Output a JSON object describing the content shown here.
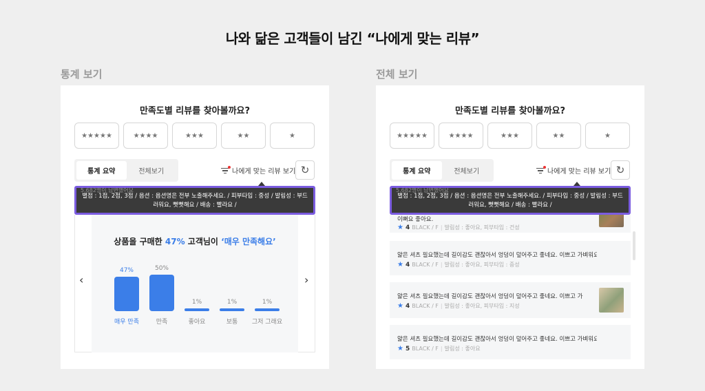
{
  "headline": "나와 닮은 고객들이 남긴 “나에게 맞는 리뷰”",
  "left_panel": {
    "section_label": "통계 보기",
    "title": "만족도별 리뷰를 찾아볼까요?",
    "star_filters": [
      "★★★★★",
      "★★★★",
      "★★★",
      "★★",
      "★"
    ],
    "tabs": [
      "통계 요약",
      "전체보기"
    ],
    "active_tab": "통계 요약",
    "match_link": "나에게 맞는 리뷰 보기",
    "tooltip_behind": "5,682명이 답변했어요",
    "tooltip": "별점 : 1점, 2점, 3점 / 옵션 : 옵션명은 전부 노출해주세요. / 피부타입 : 중성 / 발림성 : 부드러워요, 뻣뻣해요 / 배송 : 빨라요 /",
    "stats_sentence": {
      "prefix": "상품을 구매한 ",
      "percent": "47%",
      "middle": " 고객님이 ",
      "quote": "‘매우 만족해요’"
    },
    "nav_prev": "‹",
    "nav_next": "›"
  },
  "chart_data": {
    "type": "bar",
    "categories": [
      "매우 만족",
      "만족",
      "좋아요",
      "보통",
      "그저 그래요"
    ],
    "values": [
      47,
      50,
      1,
      1,
      1
    ],
    "value_labels": [
      "47%",
      "50%",
      "1%",
      "1%",
      "1%"
    ],
    "highlight_index": 0,
    "title": "",
    "xlabel": "",
    "ylabel": "",
    "ylim": [
      0,
      100
    ],
    "grid": false,
    "colors": {
      "bar": "#3b7ee8",
      "highlight_text": "#3b7ee8",
      "text": "#888888"
    }
  },
  "right_panel": {
    "section_label": "전체 보기",
    "title": "만족도별 리뷰를 찾아볼까요?",
    "star_filters": [
      "★★★★★",
      "★★★★",
      "★★★",
      "★★",
      "★"
    ],
    "tabs": [
      "통계 요약",
      "전체보기"
    ],
    "active_tab": "통계 요약",
    "match_link": "나에게 맞는 리뷰 보기",
    "tooltip_behind": "5,682명이 답변했어요",
    "tooltip": "별점 : 1점, 2점, 3점 / 옵션 : 옵션명은 전부 노출해주세요. / 피부타입 : 중성 / 발림성 : 부드러워요, 뻣뻣해요 / 배송 : 빨라요 /",
    "reviews": [
      {
        "text": "이뻐요 좋아요.",
        "score": "4",
        "meta": [
          "BLACK / F",
          "발림성 : 좋아요, 피부타입 : 건성"
        ],
        "has_thumb": true
      },
      {
        "text": "얇은 셔츠 필요했는데 길이감도 괜찮아서 엉덩이 덮어주고 좋네요. 이쁘고 가벼워요~ 가오...",
        "score": "4",
        "meta": [
          "BLACK / F",
          "발림성 : 좋아요, 피부타입 : 중성"
        ],
        "has_thumb": false
      },
      {
        "text": "얇은 셔츠 필요했는데 길이감도 괜찮아서 엉덩이 덮어주고 좋네요. 이쁘고 가...",
        "score": "4",
        "meta": [
          "BLACK / F",
          "발림성 : 좋아요, 피부타입 : 지성"
        ],
        "has_thumb": true
      },
      {
        "text": "얇은 셔츠 필요했는데 길이감도 괜찮아서 엉덩이 덮어주고 좋네요. 이쁘고 가벼워요~ 가오...",
        "score": "5",
        "meta": [
          "BLACK / F",
          "발림성 : 좋아요"
        ],
        "has_thumb": false
      }
    ]
  },
  "colors": {
    "accent": "#3b7ee8",
    "tooltip_border": "#7b5ce0",
    "tooltip_bg": "#3a3a3a",
    "alert_dot": "#e33333"
  }
}
